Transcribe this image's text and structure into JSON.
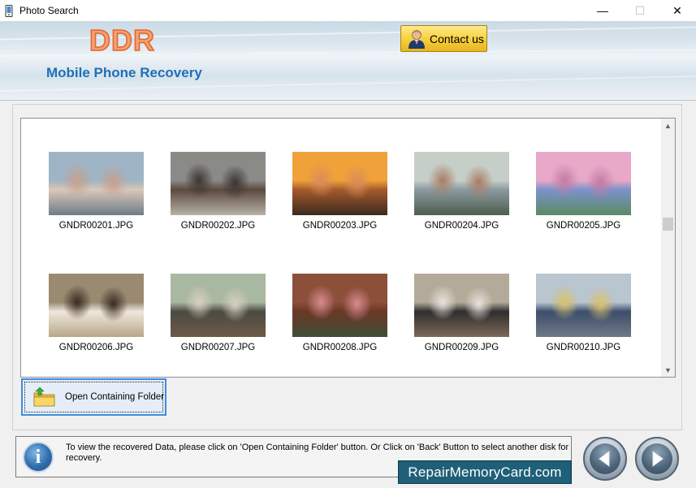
{
  "window": {
    "title": "Photo Search",
    "controls": {
      "minimize": "—",
      "maximize": "☐",
      "close": "✕"
    }
  },
  "header": {
    "brand": "DDR",
    "subtitle": "Mobile Phone Recovery",
    "contact_label": "Contact us"
  },
  "gallery": {
    "items": [
      {
        "name": "GNDR00201.JPG",
        "colors": [
          "#9fb4c4",
          "#d9c7b8",
          "#c7a08c",
          "#6d7c88"
        ]
      },
      {
        "name": "GNDR00202.JPG",
        "colors": [
          "#8a8a86",
          "#5d4a3d",
          "#3a3432",
          "#b8b2a8"
        ]
      },
      {
        "name": "GNDR00203.JPG",
        "colors": [
          "#f0a13a",
          "#a35a2b",
          "#d98c5a",
          "#3b2a20"
        ]
      },
      {
        "name": "GNDR00204.JPG",
        "colors": [
          "#c6cec8",
          "#8a9aa0",
          "#a97c64",
          "#4d5e4e"
        ]
      },
      {
        "name": "GNDR00205.JPG",
        "colors": [
          "#e8a8c8",
          "#7b92c9",
          "#c37aa3",
          "#5c8a64"
        ]
      },
      {
        "name": "GNDR00206.JPG",
        "colors": [
          "#9a8a72",
          "#efe7dc",
          "#3a2a22",
          "#b7a78a"
        ]
      },
      {
        "name": "GNDR00207.JPG",
        "colors": [
          "#a9b8a0",
          "#4b4a42",
          "#d9cfc0",
          "#6e5a48"
        ]
      },
      {
        "name": "GNDR00208.JPG",
        "colors": [
          "#8b4f3a",
          "#6a3826",
          "#d98a8f",
          "#3f4e38"
        ]
      },
      {
        "name": "GNDR00209.JPG",
        "colors": [
          "#b4aa9a",
          "#2e2e2e",
          "#e8e2da",
          "#7d6a58"
        ]
      },
      {
        "name": "GNDR00210.JPG",
        "colors": [
          "#b9c5cf",
          "#3d4d6b",
          "#d8c36a",
          "#6e7a86"
        ]
      }
    ]
  },
  "actions": {
    "open_folder_label": "Open Containing Folder"
  },
  "infobar": {
    "icon": "info-icon",
    "text": "To view the recovered Data, please click on 'Open Containing Folder' button. Or Click on 'Back' Button to select another disk for recovery."
  },
  "badge": "RepairMemoryCard.com",
  "nav": {
    "back_icon": "back-arrow-icon",
    "next_icon": "next-arrow-icon"
  }
}
